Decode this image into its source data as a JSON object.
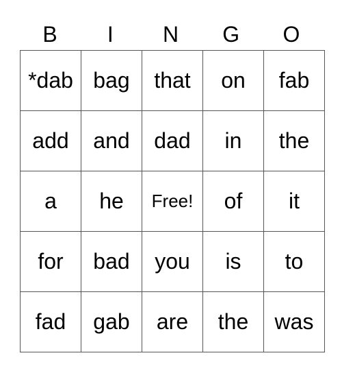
{
  "header": [
    "B",
    "I",
    "N",
    "G",
    "O"
  ],
  "cells": [
    [
      "*dab",
      "bag",
      "that",
      "on",
      "fab"
    ],
    [
      "add",
      "and",
      "dad",
      "in",
      "the"
    ],
    [
      "a",
      "he",
      "Free!",
      "of",
      "it"
    ],
    [
      "for",
      "bad",
      "you",
      "is",
      "to"
    ],
    [
      "fad",
      "gab",
      "are",
      "the",
      "was"
    ]
  ]
}
